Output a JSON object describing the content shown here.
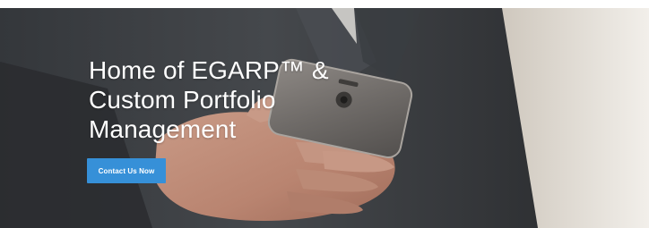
{
  "hero": {
    "headline_line1": "Home of EGARP™ &",
    "headline_line2": "Custom Portfolio",
    "headline_line3": "Management",
    "cta_label": "Contact Us Now"
  },
  "colors": {
    "cta_background": "#3690d8",
    "headline_text": "#ffffff"
  }
}
